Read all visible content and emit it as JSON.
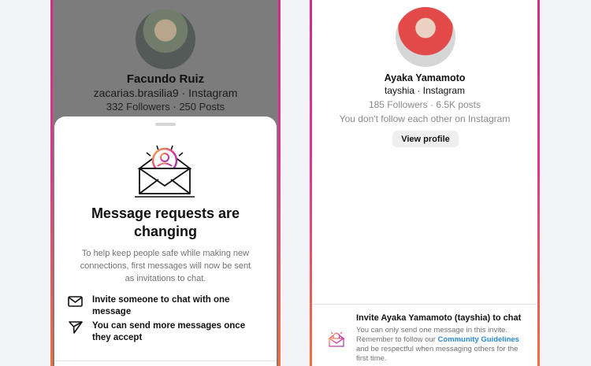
{
  "left_screen": {
    "background_profile": {
      "name": "Facundo Ruiz",
      "handle_line": "zacarias.brasilia9 · Instagram",
      "stats_line": "332 Followers · 250 Posts"
    },
    "sheet": {
      "title": "Message requests are changing",
      "body": "To help keep people safe while making new connections, first messages will now be sent as invitations to chat.",
      "features": [
        {
          "icon": "mail-icon",
          "text": "Invite someone to chat with one message"
        },
        {
          "icon": "send-icon",
          "text": "You can send more messages once they accept"
        }
      ]
    }
  },
  "right_screen": {
    "profile": {
      "name": "Ayaka Yamamoto",
      "handle_line": "tayshia · Instagram",
      "stats_line": "185 Followers · 6.5K posts",
      "follow_status": "You don't follow each other on Instagram",
      "view_profile_label": "View profile"
    },
    "invite": {
      "title": "Invite Ayaka Yamamoto (tayshia) to chat",
      "body_before_link": "You can only send one message in this invite. Remember to follow our ",
      "link_text": "Community Guidelines",
      "body_after_link": " and be respectful when messaging others for the first time."
    }
  },
  "colors": {
    "accent_gradient_start": "#cf2d86",
    "accent_gradient_end": "#f2703b",
    "link": "#2c8ad9",
    "secondary_text": "#737373"
  }
}
